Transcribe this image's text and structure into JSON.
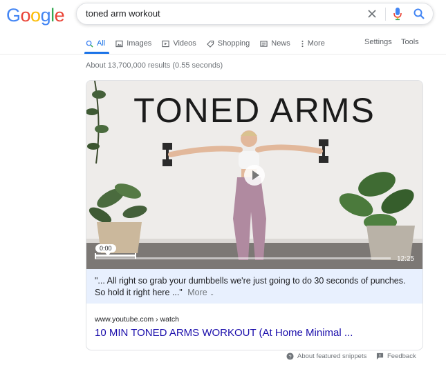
{
  "logo": {
    "text": "Google",
    "letters": [
      {
        "ch": "G",
        "color": "#4285F4"
      },
      {
        "ch": "o",
        "color": "#EA4335"
      },
      {
        "ch": "o",
        "color": "#FBBC05"
      },
      {
        "ch": "g",
        "color": "#4285F4"
      },
      {
        "ch": "l",
        "color": "#34A853"
      },
      {
        "ch": "e",
        "color": "#EA4335"
      }
    ]
  },
  "search": {
    "query": "toned arm workout"
  },
  "tabs": [
    {
      "label": "All",
      "icon": "search-icon"
    },
    {
      "label": "Images",
      "icon": "image-icon"
    },
    {
      "label": "Videos",
      "icon": "play-icon"
    },
    {
      "label": "Shopping",
      "icon": "tag-icon"
    },
    {
      "label": "News",
      "icon": "newspaper-icon"
    },
    {
      "label": "More",
      "icon": "more-vertical-icon"
    }
  ],
  "tools": {
    "settings": "Settings",
    "tools": "Tools"
  },
  "result_stats": "About 13,700,000 results (0.55 seconds)",
  "featured": {
    "video_title": "TONED ARMS",
    "current_time": "0:00",
    "duration": "12:25",
    "snippet": "\"... All right so grab your dumbbells we're just going to do 30 seconds of punches. So hold it right here ...\"",
    "more": "More",
    "source": "www.youtube.com › watch",
    "title": "10 MIN TONED ARMS WORKOUT (At Home Minimal ..."
  },
  "footer": {
    "about": "About featured snippets",
    "feedback": "Feedback"
  },
  "colors": {
    "accent": "#1a73e8",
    "link": "#1a0dab",
    "snippet_bg": "#e8f0fe"
  }
}
